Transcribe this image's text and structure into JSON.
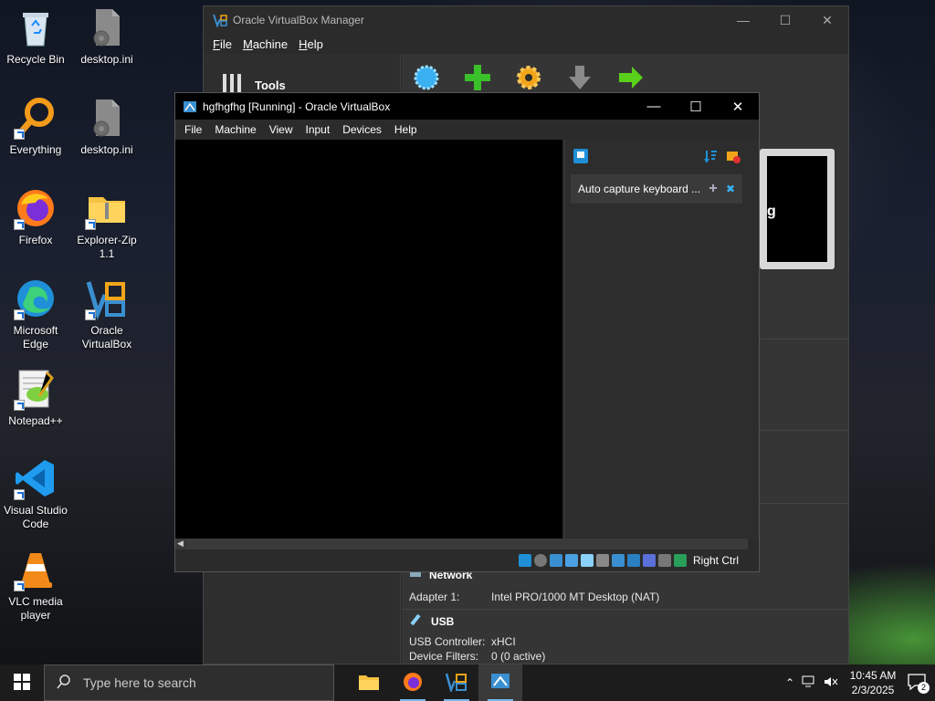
{
  "desktop": {
    "icons": [
      {
        "label": "Recycle Bin"
      },
      {
        "label": "desktop.ini"
      },
      {
        "label": "Everything"
      },
      {
        "label": "desktop.ini"
      },
      {
        "label": "Firefox"
      },
      {
        "label": "Explorer-Zip 1.1"
      },
      {
        "label": "Microsoft Edge"
      },
      {
        "label": "Oracle VirtualBox"
      },
      {
        "label": "Notepad++"
      },
      {
        "label": "Visual Studio Code"
      },
      {
        "label": "VLC media player"
      }
    ]
  },
  "manager": {
    "title": "Oracle VirtualBox Manager",
    "menu": [
      "File",
      "Machine",
      "Help"
    ],
    "tools_label": "Tools",
    "preview_text": "g",
    "network_section": "Network",
    "adapter_key": "Adapter 1:",
    "adapter_val": "Intel PRO/1000 MT Desktop (NAT)",
    "usb_section": "USB",
    "usb_controller_key": "USB Controller:",
    "usb_controller_val": "xHCI",
    "device_filters_key": "Device Filters:",
    "device_filters_val": "0 (0 active)"
  },
  "vm": {
    "title": "hgfhgfhg [Running] - Oracle VirtualBox",
    "menu": [
      "File",
      "Machine",
      "View",
      "Input",
      "Devices",
      "Help"
    ],
    "notice_text": "Auto capture keyboard ...",
    "host_key": "Right Ctrl"
  },
  "taskbar": {
    "search_placeholder": "Type here to search",
    "time": "10:45 AM",
    "date": "2/3/2025",
    "notification_count": "2"
  },
  "colors": {
    "accent": "#76b9ed",
    "vbox_blue": "#1a6fd8",
    "green": "#39c02a"
  }
}
